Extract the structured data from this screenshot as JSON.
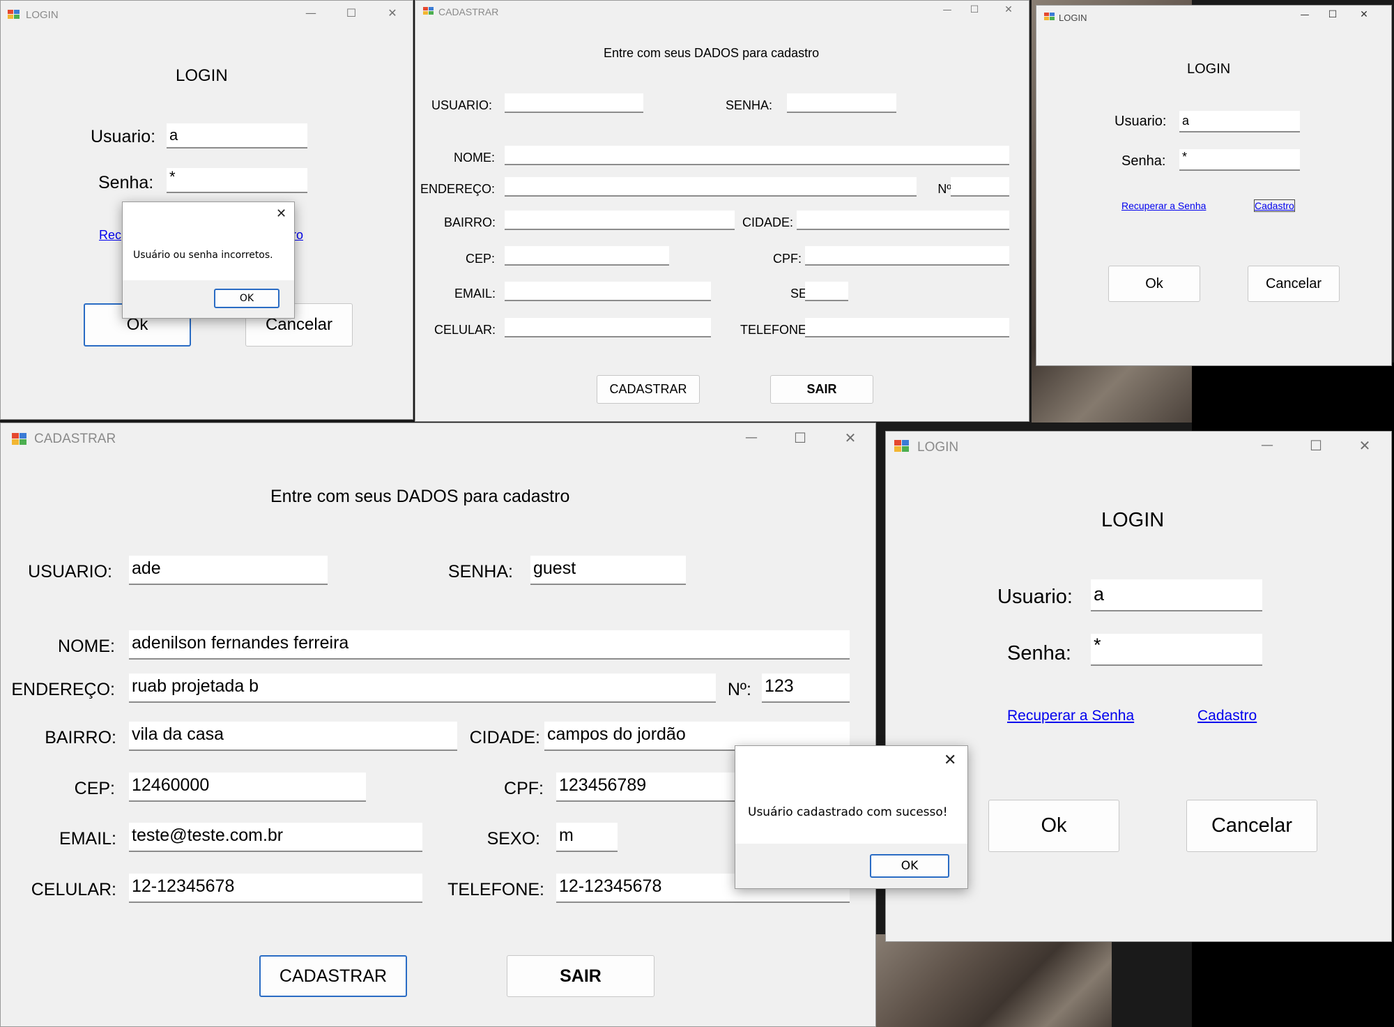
{
  "colors": {
    "window_bg": "#f0f0f0",
    "field_bg": "#ffffff",
    "link": "#0000ee",
    "focus_border": "#2a6cc4",
    "title_text": "#8a8a8a"
  },
  "icons": {
    "app_icon": "windows-forms-app-icon",
    "minimize": "minimize-icon",
    "maximize": "maximize-icon",
    "close": "close-icon"
  },
  "caption_glyphs": {
    "minimize": "—",
    "maximize": "☐",
    "close": "✕"
  },
  "login1": {
    "title": "LOGIN",
    "heading": "LOGIN",
    "usuario_label": "Usuario:",
    "usuario_value": "a",
    "senha_label": "Senha:",
    "senha_value": "*",
    "link_left_visible": "Rec",
    "link_right_visible": "ro",
    "ok": "Ok",
    "cancel": "Cancelar",
    "dialog": {
      "message": "Usuário ou senha incorretos.",
      "ok": "OK",
      "close": "✕"
    }
  },
  "cad1": {
    "title": "CADASTRAR",
    "heading": "Entre com seus DADOS para cadastro",
    "labels": {
      "usuario": "USUARIO:",
      "senha": "SENHA:",
      "nome": "NOME:",
      "endereco": "ENDEREÇO:",
      "numero": "Nº:",
      "bairro": "BAIRRO:",
      "cidade": "CIDADE:",
      "cep": "CEP:",
      "cpf": "CPF:",
      "email": "EMAIL:",
      "sexo": "SEXO:",
      "celular": "CELULAR:",
      "telefone": "TELEFONE:"
    },
    "values": {
      "usuario": "",
      "senha": "",
      "nome": "",
      "endereco": "",
      "numero": "",
      "bairro": "",
      "cidade": "",
      "cep": "",
      "cpf": "",
      "email": "",
      "sexo": "",
      "celular": "",
      "telefone": ""
    },
    "cadastrar": "CADASTRAR",
    "sair": "SAIR"
  },
  "login2": {
    "title": "LOGIN",
    "heading": "LOGIN",
    "usuario_label": "Usuario:",
    "usuario_value": "a",
    "senha_label": "Senha:",
    "senha_value": "*",
    "recuperar": "Recuperar a Senha",
    "cadastro": "Cadastro",
    "ok": "Ok",
    "cancel": "Cancelar"
  },
  "cad2": {
    "title": "CADASTRAR",
    "heading": "Entre com seus DADOS para cadastro",
    "labels": {
      "usuario": "USUARIO:",
      "senha": "SENHA:",
      "nome": "NOME:",
      "endereco": "ENDEREÇO:",
      "numero": "Nº:",
      "bairro": "BAIRRO:",
      "cidade": "CIDADE:",
      "cep": "CEP:",
      "cpf": "CPF:",
      "email": "EMAIL:",
      "sexo": "SEXO:",
      "celular": "CELULAR:",
      "telefone": "TELEFONE:"
    },
    "values": {
      "usuario": "ade",
      "senha": "guest",
      "nome": "adenilson fernandes ferreira",
      "endereco": "ruab projetada b",
      "numero": "123",
      "bairro": "vila da casa",
      "cidade": "campos do jordão",
      "cep": "12460000",
      "cpf": "123456789",
      "email": "teste@teste.com.br",
      "sexo": "m",
      "celular": "12-12345678",
      "telefone": "12-12345678"
    },
    "cadastrar": "CADASTRAR",
    "sair": "SAIR"
  },
  "login3": {
    "title": "LOGIN",
    "heading": "LOGIN",
    "usuario_label": "Usuario:",
    "usuario_value": "a",
    "senha_label": "Senha:",
    "senha_value": "*",
    "recuperar": "Recuperar a Senha",
    "cadastro": "Cadastro",
    "ok": "Ok",
    "cancel": "Cancelar"
  },
  "dialog2": {
    "message": "Usuário cadastrado com sucesso!",
    "ok": "OK",
    "close": "✕"
  }
}
